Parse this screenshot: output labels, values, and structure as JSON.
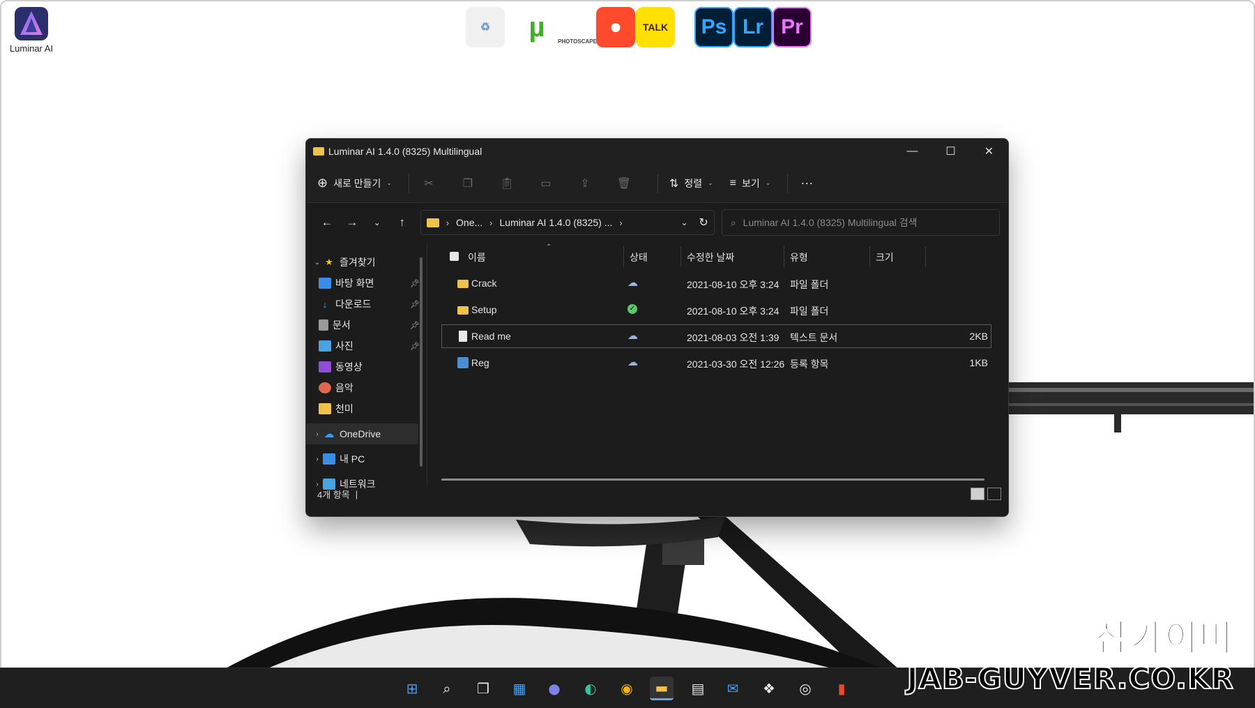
{
  "desktop": {
    "icon_label": "Luminar AI",
    "top_apps": [
      {
        "name": "recycle-bin",
        "label": ""
      },
      {
        "name": "utorrent",
        "label": ""
      },
      {
        "name": "photoscape",
        "label": "PHOTOSCAPE"
      },
      {
        "name": "gom-player",
        "label": ""
      },
      {
        "name": "kakaotalk",
        "label": "TALK"
      },
      {
        "name": "photoshop",
        "label": "Ps"
      },
      {
        "name": "lightroom",
        "label": "Lr"
      },
      {
        "name": "premiere",
        "label": "Pr"
      }
    ]
  },
  "window": {
    "title": "Luminar AI 1.4.0 (8325) Multilingual",
    "toolbar": {
      "new_label": "새로 만들기",
      "sort_label": "정렬",
      "view_label": "보기",
      "more_label": "···"
    },
    "address": {
      "crumb1": "One...",
      "crumb2": "Luminar AI 1.4.0 (8325) ...",
      "search_placeholder": "Luminar AI 1.4.0 (8325) Multilingual 검색"
    },
    "sidebar": {
      "favorites": "즐겨찾기",
      "items": [
        {
          "label": "바탕 화면",
          "pinned": true
        },
        {
          "label": "다운로드",
          "pinned": true
        },
        {
          "label": "문서",
          "pinned": true
        },
        {
          "label": "사진",
          "pinned": true
        },
        {
          "label": "동영상",
          "pinned": false
        },
        {
          "label": "음악",
          "pinned": false
        },
        {
          "label": "천미",
          "pinned": false
        }
      ],
      "onedrive": "OneDrive",
      "pc": "내 PC",
      "network": "네트워크"
    },
    "columns": {
      "name": "이름",
      "status": "상태",
      "modified": "수정한 날짜",
      "type": "유형",
      "size": "크기"
    },
    "files": [
      {
        "name": "Crack",
        "date": "2021-08-10 오후 3:24",
        "type": "파일 폴더",
        "size": "",
        "kind": "folder",
        "status": "cloud"
      },
      {
        "name": "Setup",
        "date": "2021-08-10 오후 3:24",
        "type": "파일 폴더",
        "size": "",
        "kind": "folder",
        "status": "synced"
      },
      {
        "name": "Read me",
        "date": "2021-08-03 오전 1:39",
        "type": "텍스트 문서",
        "size": "2KB",
        "kind": "text",
        "status": "cloud"
      },
      {
        "name": "Reg",
        "date": "2021-03-30 오전 12:26",
        "type": "등록 항목",
        "size": "1KB",
        "kind": "reg",
        "status": "cloud"
      }
    ],
    "status": "4개 항목"
  },
  "watermark": {
    "ko": "잡가이버",
    "en": "JAB-GUYVER.CO.KR"
  },
  "colors": {
    "folder": "#f1c24b",
    "window_bg": "#1c1c1c",
    "taskbar_bg": "#1f1f1f"
  }
}
